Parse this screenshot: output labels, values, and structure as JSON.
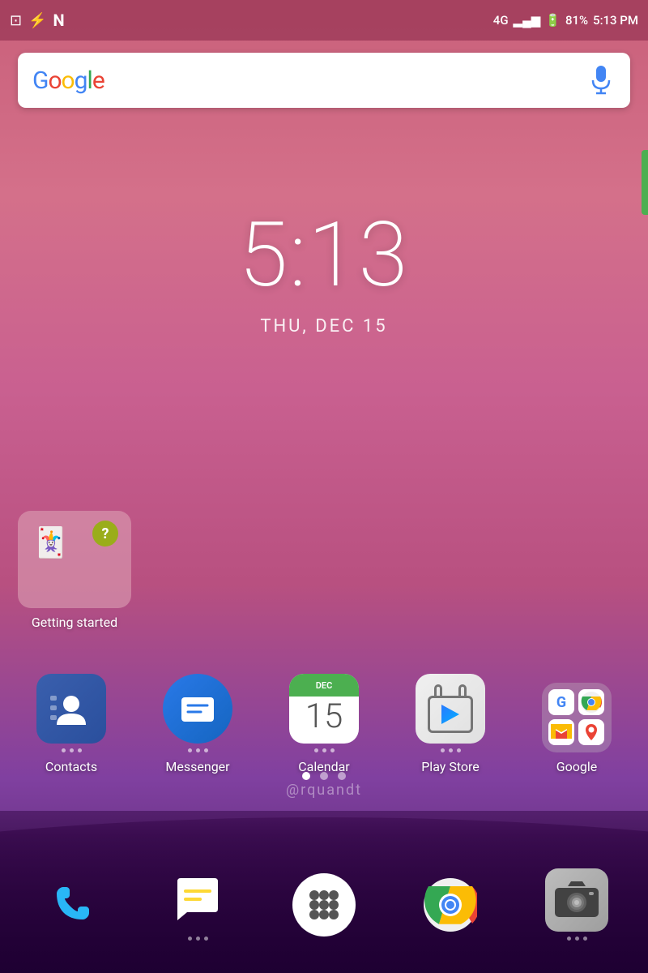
{
  "statusBar": {
    "time": "5:13 PM",
    "battery": "81%",
    "signal": "4G",
    "icons": [
      "image-icon",
      "flash-icon",
      "n-icon"
    ]
  },
  "searchBar": {
    "placeholder": "Google",
    "micLabel": "Voice Search"
  },
  "clock": {
    "time": "5:13",
    "date": "THU, DEC 15"
  },
  "gettingStarted": {
    "label": "Getting started"
  },
  "appRow": [
    {
      "id": "contacts",
      "label": "Contacts",
      "hasDots": true
    },
    {
      "id": "messenger",
      "label": "Messenger",
      "hasDots": true
    },
    {
      "id": "calendar",
      "label": "Calendar",
      "hasDots": true,
      "calNumber": "15"
    },
    {
      "id": "playstore",
      "label": "Play Store",
      "hasDots": true
    },
    {
      "id": "google",
      "label": "Google",
      "hasDots": false
    }
  ],
  "pageDots": [
    {
      "active": true
    },
    {
      "active": false
    },
    {
      "active": false
    }
  ],
  "bottomDock": [
    {
      "id": "phone",
      "hasDots": false
    },
    {
      "id": "messages",
      "hasDots": true
    },
    {
      "id": "apps",
      "hasDots": false
    },
    {
      "id": "chrome",
      "hasDots": false
    },
    {
      "id": "camera",
      "hasDots": true
    }
  ],
  "watermark": "@rquandt",
  "colors": {
    "bgTop": "#c9607a",
    "bgBottom": "#3a0050",
    "accent": "#4caf50"
  }
}
